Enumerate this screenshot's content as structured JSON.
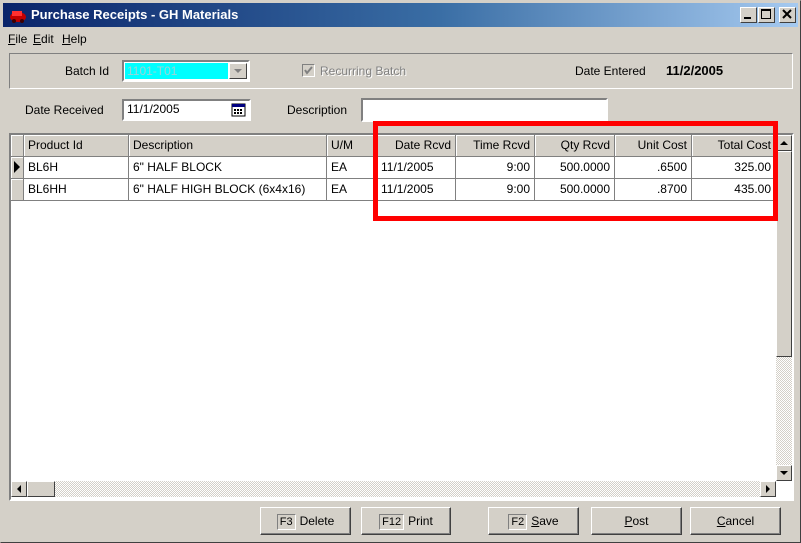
{
  "window": {
    "title": "Purchase Receipts - GH Materials",
    "min_label": "_",
    "max_label": "□",
    "close_label": "×"
  },
  "menu": [
    {
      "prefix": "F",
      "rest": "ile"
    },
    {
      "prefix": "E",
      "rest": "dit"
    },
    {
      "prefix": "H",
      "rest": "elp"
    }
  ],
  "header": {
    "batch_id_label": "Batch Id",
    "batch_id_value": "1101-T01",
    "recurring_batch_label": "Recurring Batch",
    "recurring_batch_checked": true,
    "date_entered_label": "Date Entered",
    "date_entered_value": "11/2/2005",
    "date_received_label": "Date Received",
    "date_received_value": "11/1/2005",
    "description_label": "Description",
    "description_value": ""
  },
  "grid": {
    "columns": [
      "Product Id",
      "Description",
      "U/M",
      "Date Rcvd",
      "Time Rcvd",
      "Qty Rcvd",
      "Unit Cost",
      "Total Cost"
    ],
    "rows": [
      [
        "BL6H",
        "6\" HALF BLOCK",
        "EA",
        "11/1/2005",
        "9:00",
        "500.0000",
        ".6500",
        "325.00"
      ],
      [
        "BL6HH",
        "6\" HALF HIGH BLOCK (6x4x16)",
        "EA",
        "11/1/2005",
        "9:00",
        "500.0000",
        ".8700",
        "435.00"
      ]
    ],
    "current_row": 0
  },
  "buttons": {
    "delete": {
      "key": "F3",
      "label": "Delete"
    },
    "print": {
      "key": "F12",
      "label": "Print"
    },
    "save": {
      "key": "F2",
      "prefix": "S",
      "rest": "ave"
    },
    "post": {
      "prefix": "P",
      "rest": "ost"
    },
    "cancel": {
      "prefix": "C",
      "rest": "ancel"
    }
  },
  "colors": {
    "highlight": "#ff0000",
    "batch_field_bg": "#00ffff",
    "title_bar": "#0a246a"
  }
}
